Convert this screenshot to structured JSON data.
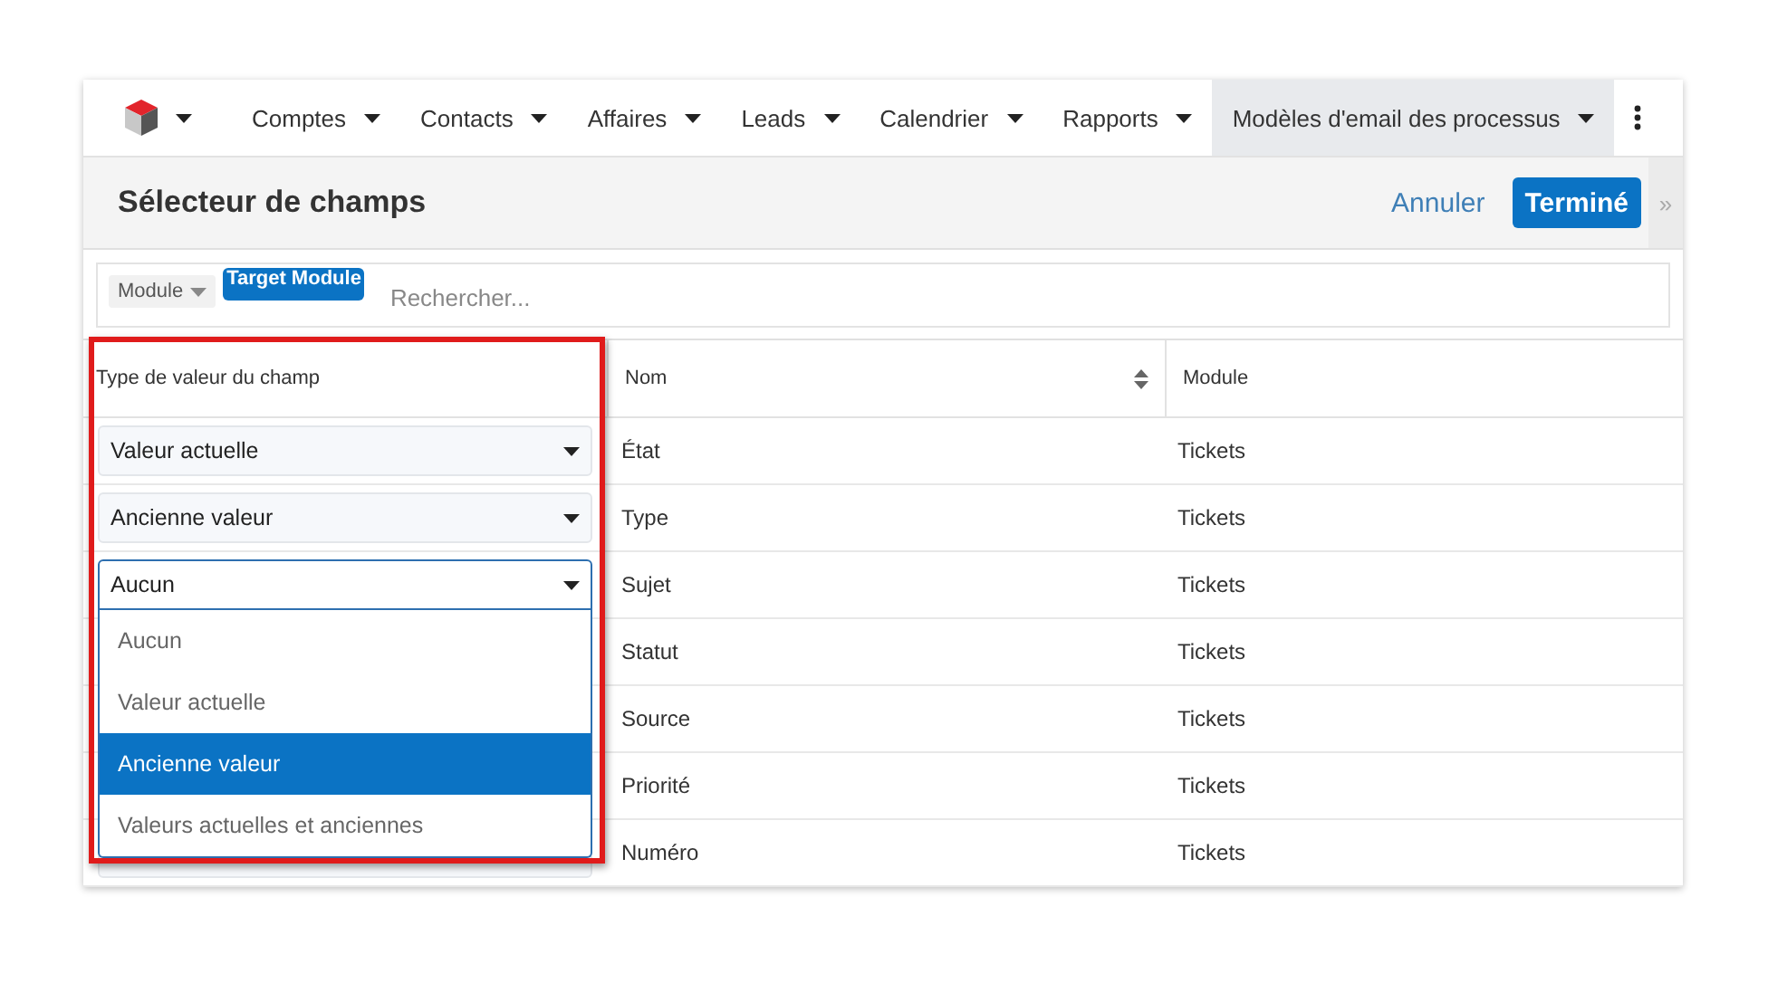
{
  "nav": {
    "items": [
      {
        "label": "Comptes",
        "selected": false
      },
      {
        "label": "Contacts",
        "selected": false
      },
      {
        "label": "Affaires",
        "selected": false
      },
      {
        "label": "Leads",
        "selected": false
      },
      {
        "label": "Calendrier",
        "selected": false
      },
      {
        "label": "Rapports",
        "selected": false
      },
      {
        "label": "Modèles d'email des processus",
        "selected": true
      }
    ]
  },
  "header": {
    "title": "Sélecteur de champs",
    "cancel": "Annuler",
    "done": "Terminé",
    "expand": "»"
  },
  "filter": {
    "module_chip": "Module",
    "target_chip": "Target Module",
    "search": {
      "placeholder": "Rechercher..."
    }
  },
  "table": {
    "columns": [
      "Type de valeur du champ",
      "Nom",
      "Module"
    ],
    "rows": [
      {
        "value_type": "Valeur actuelle",
        "open": false,
        "name": "État",
        "module": "Tickets"
      },
      {
        "value_type": "Ancienne valeur",
        "open": false,
        "name": "Type",
        "module": "Tickets"
      },
      {
        "value_type": "Aucun",
        "open": true,
        "options": [
          {
            "label": "Aucun",
            "selected": false
          },
          {
            "label": "Valeur actuelle",
            "selected": false
          },
          {
            "label": "Ancienne valeur",
            "selected": true
          },
          {
            "label": "Valeurs actuelles et anciennes",
            "selected": false
          }
        ],
        "name": "Sujet",
        "module": "Tickets"
      },
      {
        "name": "Statut",
        "module": "Tickets"
      },
      {
        "name": "Source",
        "module": "Tickets"
      },
      {
        "name": "Priorité",
        "module": "Tickets"
      },
      {
        "open": false,
        "name": "Numéro",
        "module": "Tickets"
      }
    ]
  }
}
